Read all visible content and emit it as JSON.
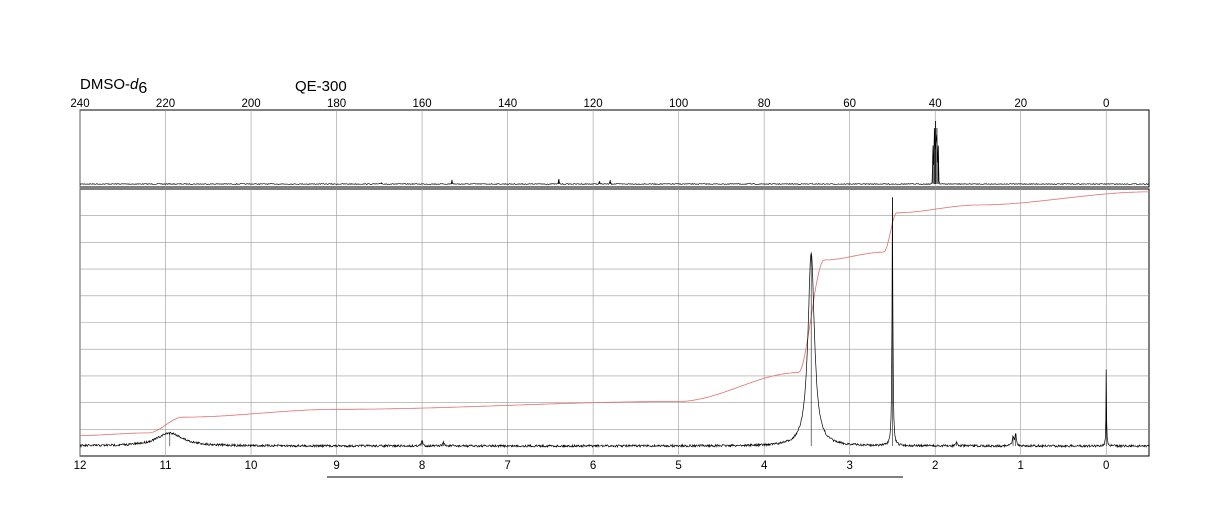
{
  "header": {
    "solvent_prefix": "DMSO-",
    "solvent_italic": "d",
    "solvent_sub": "6",
    "instrument": "QE-300"
  },
  "chart_data": [
    {
      "type": "line",
      "name": "13C NMR spectrum",
      "xlabel": "",
      "ylabel": "",
      "xlim": [
        240,
        -10
      ],
      "x_reversed": true,
      "grid": true,
      "tick_labels": [
        "240",
        "220",
        "200",
        "180",
        "160",
        "140",
        "120",
        "100",
        "80",
        "60",
        "40",
        "20",
        "0"
      ],
      "ticks": [
        240,
        220,
        200,
        180,
        160,
        140,
        120,
        100,
        80,
        60,
        40,
        20,
        0
      ],
      "peaks": [
        {
          "x": 169.5,
          "y": 0.02
        },
        {
          "x": 153.0,
          "y": 0.06
        },
        {
          "x": 128.0,
          "y": 0.07
        },
        {
          "x": 118.5,
          "y": 0.04
        },
        {
          "x": 116.0,
          "y": 0.06
        },
        {
          "x": 40.5,
          "y": 0.55
        },
        {
          "x": 40.2,
          "y": 0.8
        },
        {
          "x": 39.9,
          "y": 0.9
        },
        {
          "x": 39.6,
          "y": 0.8
        },
        {
          "x": 39.3,
          "y": 0.55
        }
      ]
    },
    {
      "type": "line",
      "name": "1H NMR spectrum",
      "xlabel": "",
      "ylabel": "",
      "xlim": [
        12,
        -0.5
      ],
      "x_reversed": true,
      "grid": true,
      "tick_labels": [
        "12",
        "11",
        "10",
        "9",
        "8",
        "7",
        "6",
        "5",
        "4",
        "3",
        "2",
        "1",
        "0"
      ],
      "ticks": [
        12,
        11,
        10,
        9,
        8,
        7,
        6,
        5,
        4,
        3,
        2,
        1,
        0
      ],
      "peaks": [
        {
          "x": 10.95,
          "y": 0.05,
          "width": 0.18
        },
        {
          "x": 8.0,
          "y": 0.02,
          "width": 0.01
        },
        {
          "x": 7.75,
          "y": 0.015,
          "width": 0.01
        },
        {
          "x": 3.45,
          "y": 0.74,
          "width": 0.045
        },
        {
          "x": 2.5,
          "y": 0.95,
          "width": 0.006
        },
        {
          "x": 1.75,
          "y": 0.015,
          "width": 0.01
        },
        {
          "x": 1.09,
          "y": 0.035,
          "width": 0.01
        },
        {
          "x": 1.06,
          "y": 0.045,
          "width": 0.01
        },
        {
          "x": 0.0,
          "y": 0.29,
          "width": 0.004
        }
      ],
      "integration": [
        {
          "x": 12.0,
          "y": 0.04
        },
        {
          "x": 11.2,
          "y": 0.05
        },
        {
          "x": 10.8,
          "y": 0.11
        },
        {
          "x": 9.0,
          "y": 0.14
        },
        {
          "x": 5.0,
          "y": 0.17
        },
        {
          "x": 3.6,
          "y": 0.28
        },
        {
          "x": 3.3,
          "y": 0.71
        },
        {
          "x": 2.6,
          "y": 0.74
        },
        {
          "x": 2.45,
          "y": 0.89
        },
        {
          "x": 1.5,
          "y": 0.92
        },
        {
          "x": -0.5,
          "y": 0.97
        }
      ]
    }
  ],
  "colors": {
    "spectrum": "#000000",
    "integration": "#e07070",
    "grid": "#9a9a9a"
  }
}
